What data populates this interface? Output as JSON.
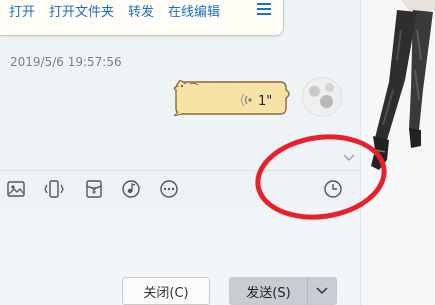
{
  "file_bubble": {
    "actions": [
      "打开",
      "打开文件夹",
      "转发",
      "在线编辑"
    ],
    "menu_icon": "hamburger-menu-icon"
  },
  "message": {
    "timestamp": "2019/5/6 19:57:56",
    "voice_duration": "1\""
  },
  "toolbar": {
    "icons": [
      "image-icon",
      "shake-icon",
      "red-packet-icon",
      "music-icon",
      "more-icon",
      "history-clock-icon"
    ]
  },
  "buttons": {
    "close_label": "关闭(C)",
    "send_label": "发送(S)"
  },
  "colors": {
    "link_blue": "#1a6fc9",
    "annotation_red": "#e8202a",
    "bubble_tan": "#f8e3a6"
  }
}
